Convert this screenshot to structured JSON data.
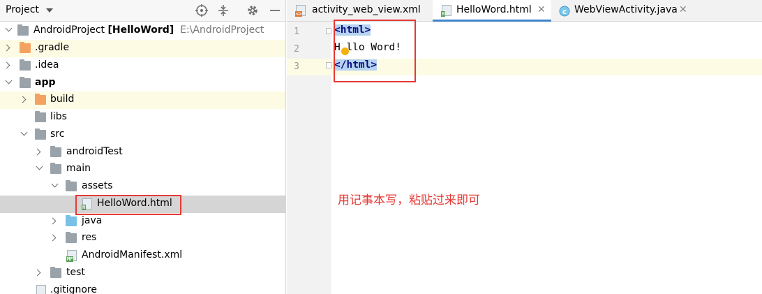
{
  "project_panel": {
    "title": "Project",
    "tree": [
      {
        "label": "AndroidProject",
        "bold_suffix": "[HelloWord]",
        "path": "E:\\AndroidProject"
      },
      {
        "label": ".gradle"
      },
      {
        "label": ".idea"
      },
      {
        "label": "app"
      },
      {
        "label": "build"
      },
      {
        "label": "libs"
      },
      {
        "label": "src"
      },
      {
        "label": "androidTest"
      },
      {
        "label": "main"
      },
      {
        "label": "assets"
      },
      {
        "label": "HelloWord.html"
      },
      {
        "label": "java"
      },
      {
        "label": "res"
      },
      {
        "label": "AndroidManifest.xml"
      },
      {
        "label": "test"
      },
      {
        "label": ".gitignore"
      }
    ]
  },
  "tabs": [
    {
      "label": "activity_web_view.xml"
    },
    {
      "label": "HelloWord.html"
    },
    {
      "label": "WebViewActivity.java"
    }
  ],
  "editor": {
    "line_numbers": [
      "1",
      "2",
      "3"
    ],
    "lines": [
      {
        "tag": "<html>"
      },
      {
        "text_first": "H",
        "text_rest": "llo Word!"
      },
      {
        "tag": "</html>"
      }
    ]
  },
  "annotation": "用记事本写，粘贴过来即可",
  "colors": {
    "highlight_red": "#e53935",
    "selection_grey": "#d5d5d5",
    "tag_bg": "#b5d2f0"
  }
}
